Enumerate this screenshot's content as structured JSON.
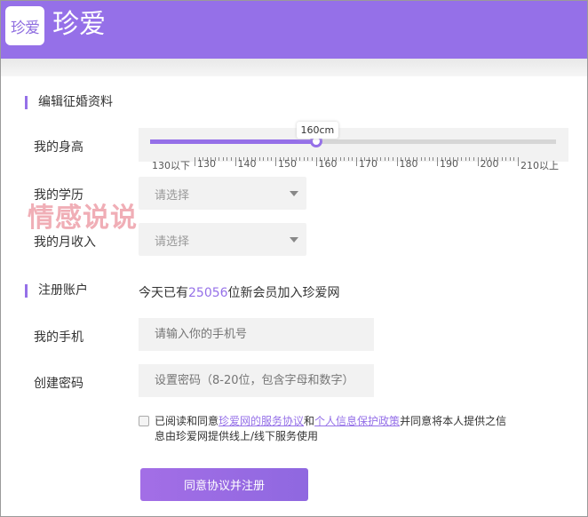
{
  "header": {
    "logo_mark": "珍爱",
    "title": "珍爱"
  },
  "watermark": "情感说说",
  "profile": {
    "section_title": "编辑征婚资料",
    "height": {
      "label": "我的身高",
      "value_cm": 160,
      "min": 125,
      "max": 215,
      "tooltip": "160cm",
      "ticks": [
        "130以下",
        "130",
        "140",
        "150",
        "160",
        "170",
        "180",
        "190",
        "200",
        "210以上"
      ]
    },
    "education": {
      "label": "我的学历",
      "placeholder": "请选择"
    },
    "income": {
      "label": "我的月收入",
      "placeholder": "请选择"
    }
  },
  "account": {
    "section_title": "注册账户",
    "stat_prefix": "今天已有",
    "stat_count": "25056",
    "stat_suffix": "位新会员加入珍爱网",
    "phone": {
      "label": "我的手机",
      "placeholder": "请输入你的手机号"
    },
    "password": {
      "label": "创建密码",
      "placeholder": "设置密码（8-20位，包含字母和数字）"
    }
  },
  "agreement": {
    "checked": false,
    "t1": "已阅读和同意",
    "link1": "珍爱网的服务协议",
    "t2": "和",
    "link2": "个人信息保护政策",
    "t3": "并同意将本人提供之信息由珍爱网提供线上/线下服务使用"
  },
  "submit_label": "同意协议并注册"
}
